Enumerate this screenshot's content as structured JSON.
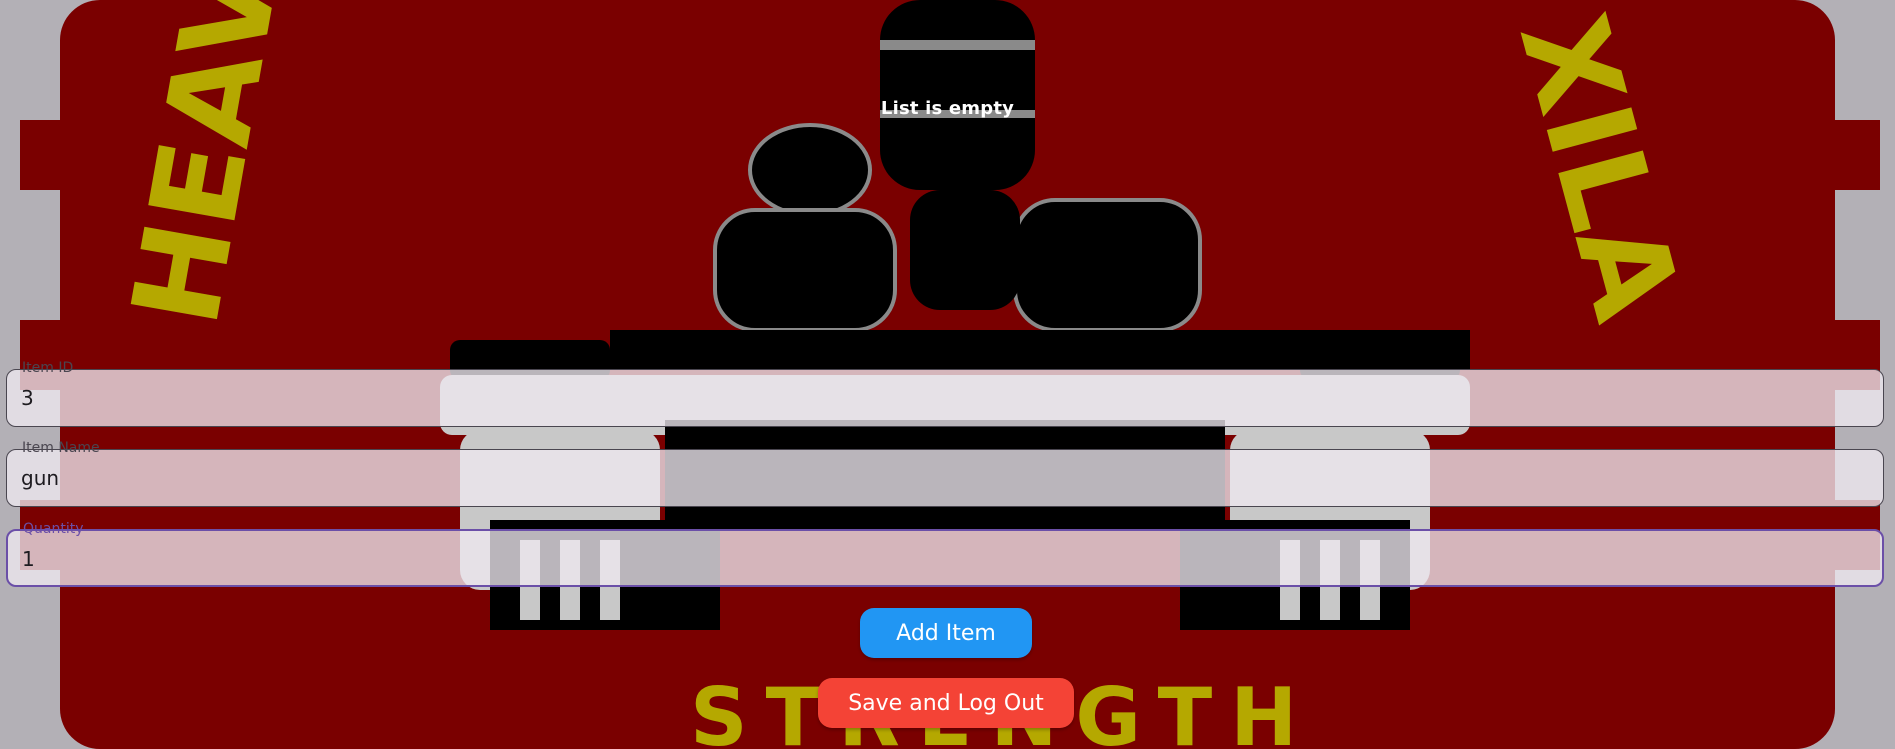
{
  "list": {
    "empty_message": "List is empty"
  },
  "form": {
    "item_id": {
      "label": "Item ID",
      "value": "3"
    },
    "item_name": {
      "label": "Item Name",
      "value": "gun"
    },
    "quantity": {
      "label": "Quantity",
      "value": "1"
    }
  },
  "actions": {
    "add_label": "Add Item",
    "save_logout_label": "Save and Log Out"
  },
  "background": {
    "logo_text_top_left": "HEAV",
    "logo_text_top_right": "XILA",
    "logo_text_bottom": "STRENGTH"
  },
  "colors": {
    "emblem_red": "#7a0000",
    "emblem_yellow": "#b5a800",
    "add_button": "#2196f3",
    "save_button": "#f44336",
    "focus_border": "#6b4fa8"
  }
}
